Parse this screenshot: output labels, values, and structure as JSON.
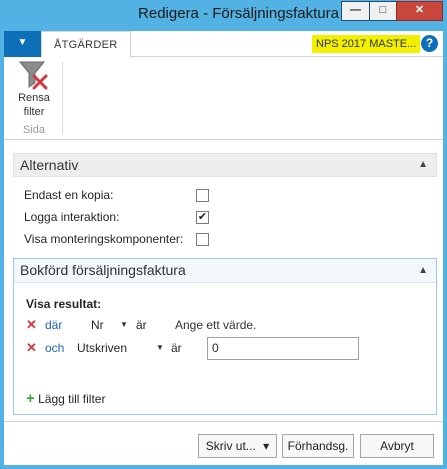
{
  "window": {
    "title": "Redigera - Försäljningsfaktura",
    "minimize": "—",
    "maximize": "□",
    "close": "✕"
  },
  "ribbon": {
    "app_menu_icon": "▼",
    "tab_label": "ÅTGÄRDER",
    "company": "NPS 2017 MASTE...",
    "help_icon": "?",
    "clear_filter_label_1": "Rensa",
    "clear_filter_label_2": "filter",
    "group_label": "Sida"
  },
  "options": {
    "header": "Alternativ",
    "rows": [
      {
        "label": "Endast en kopia:",
        "checked": false
      },
      {
        "label": "Logga interaktion:",
        "checked": true
      },
      {
        "label": "Visa monteringskomponenter:",
        "checked": false
      }
    ]
  },
  "filter": {
    "header": "Bokförd försäljningsfaktura",
    "show_results": "Visa resultat:",
    "rows": [
      {
        "conj": "där",
        "field": "Nr",
        "op": "är",
        "hint": "Ange ett värde.",
        "value": ""
      },
      {
        "conj": "och",
        "field": "Utskriven",
        "op": "är",
        "hint": "",
        "value": "0"
      }
    ],
    "add_filter": "Lägg till filter"
  },
  "footer": {
    "print": "Skriv ut...",
    "print_dd": "▾",
    "preview": "Förhandsg.",
    "cancel": "Avbryt"
  },
  "colors": {
    "window_frame": "#51b2e3",
    "accent": "#0d6fb8",
    "company_highlight": "#f0f000",
    "close_button": "#c9463d",
    "remove_x": "#d6373e",
    "add_plus": "#3aa23a"
  }
}
